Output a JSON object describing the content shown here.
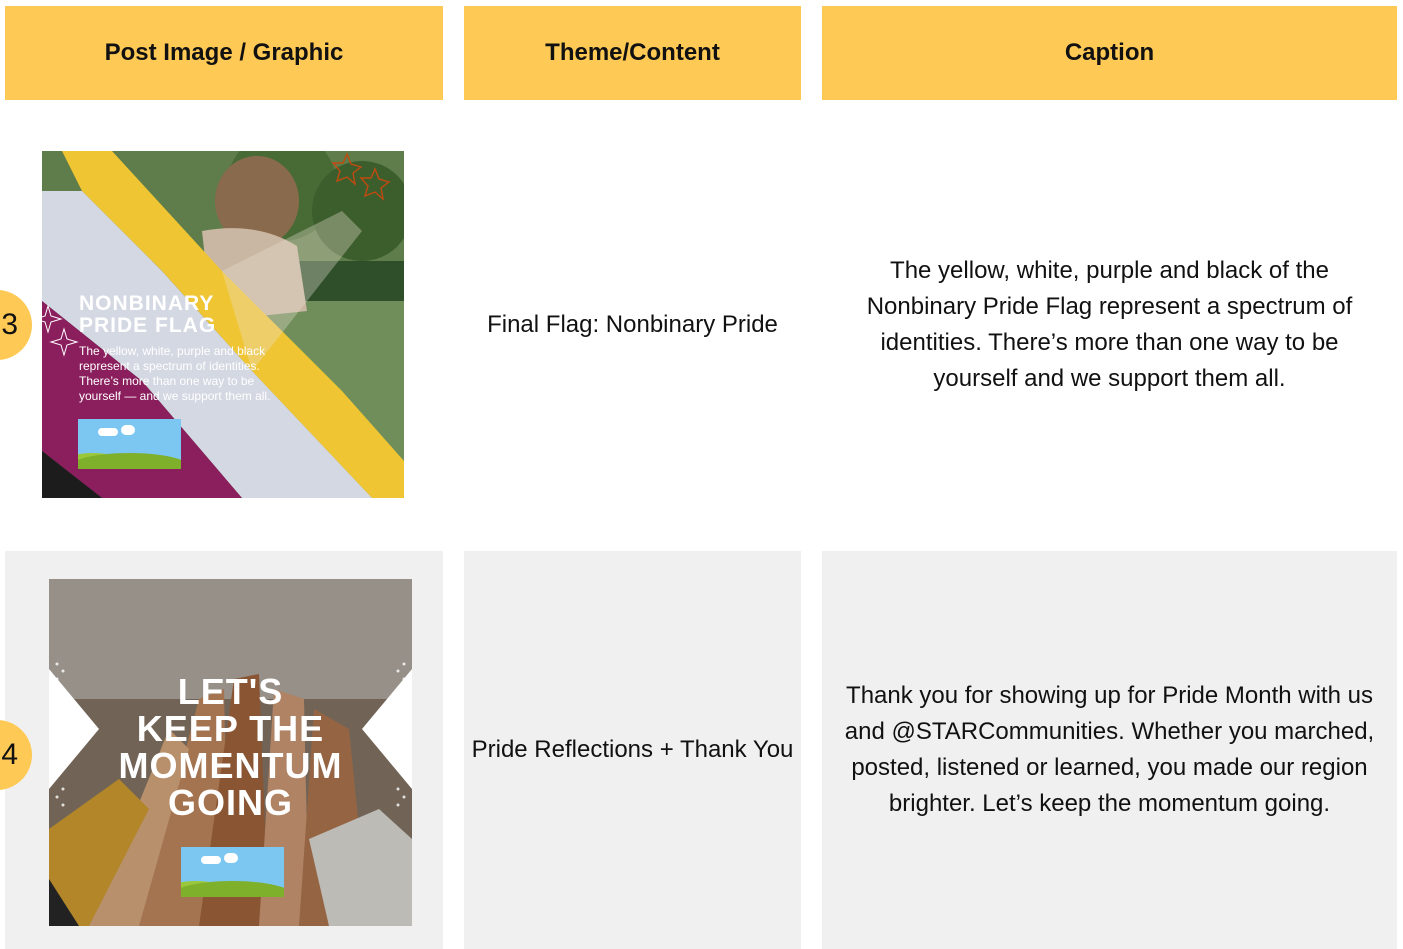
{
  "headers": {
    "post": "Post Image / Graphic",
    "theme": "Theme/Content",
    "caption": "Caption"
  },
  "rows": [
    {
      "number": "3",
      "theme": "Final Flag: Nonbinary Pride",
      "caption": "The yellow, white, purple and black of the Nonbinary Pride Flag represent a spectrum of identities. There’s more than one way to be yourself and we support them all.",
      "graphic": {
        "title_line1": "NONBINARY",
        "title_line2": "PRIDE FLAG",
        "body": "The yellow, white, purple and black represent a spectrum of identities. There’s more than one way to be yourself — and we support them all."
      }
    },
    {
      "number": "4",
      "theme": "Pride Reflections + Thank You",
      "caption": "Thank you for showing up for Pride Month with us and @STARCommunities. Whether you marched, posted, listened or learned, you made our region brighter. Let’s keep the momentum going.",
      "graphic": {
        "line1": "LET'S",
        "line2": "KEEP THE",
        "line3": "MOMENTUM",
        "line4": "GOING"
      }
    }
  ],
  "colors": {
    "header_bg": "#fec954",
    "row_alt_bg": "#f0f0f0"
  }
}
